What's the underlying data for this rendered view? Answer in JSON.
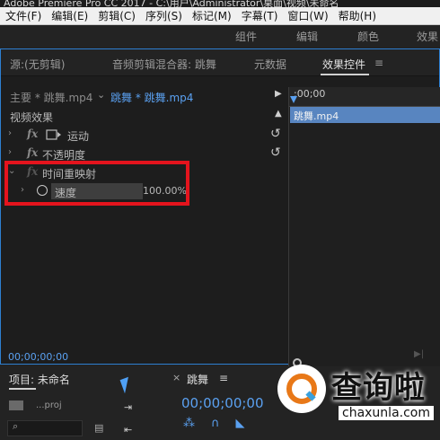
{
  "window": {
    "title": "Adobe Premiere Pro CC 2017 - C:\\用户\\Administrator\\桌面\\视频\\未命名"
  },
  "menubar": {
    "items": [
      "文件(F)",
      "编辑(E)",
      "剪辑(C)",
      "序列(S)",
      "标记(M)",
      "字幕(T)",
      "窗口(W)",
      "帮助(H)"
    ]
  },
  "workspaces": {
    "items": [
      "组件",
      "编辑",
      "颜色",
      "效果"
    ]
  },
  "panel_tabs": {
    "source": "源:(无剪辑)",
    "audio_mixer": "音频剪辑混合器: 跳舞",
    "metadata": "元数据",
    "effect_controls": "效果控件",
    "menu_icon": "≡"
  },
  "clip_selector": {
    "master": "主要 * 跳舞.mp4",
    "sequence": "跳舞 * 跳舞.mp4"
  },
  "effects": {
    "section_label": "视频效果",
    "motion": "运动",
    "opacity": "不透明度",
    "time_remap": "时间重映射",
    "speed_label": "速度",
    "speed_value": "100.00%"
  },
  "timeline": {
    "ruler_time": ":00;00",
    "clip_name": "跳舞.mp4"
  },
  "footer": {
    "timecode": "00;00;00;00"
  },
  "project_panel": {
    "tab": "项目: 未命名",
    "file": "...proj"
  },
  "sequence_panel": {
    "tab": "跳舞",
    "menu_icon": "≡",
    "timecode": "00;00;00;00"
  },
  "watermark": {
    "brand": "查询啦",
    "url": "chaxunla.com"
  },
  "colors": {
    "accent": "#2d7fd1",
    "highlight": "#e4141d",
    "clip": "#5885c0"
  }
}
